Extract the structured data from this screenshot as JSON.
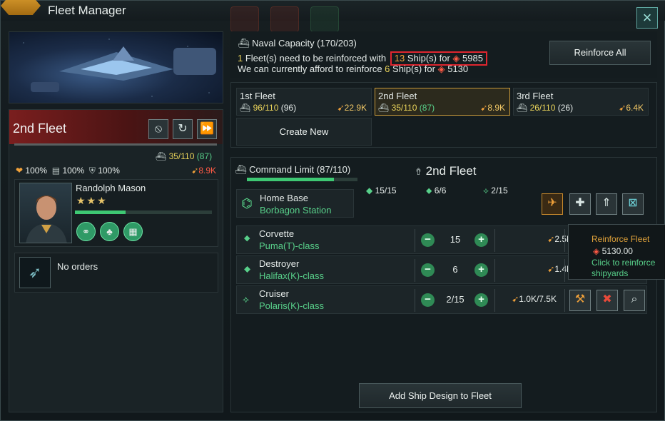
{
  "window": {
    "title": "Fleet Manager",
    "close_icon": "×"
  },
  "left": {
    "fleet_name": "2nd Fleet",
    "capacity": "35/110",
    "capacity_extra": "(87)",
    "stats": {
      "hull": "100%",
      "armor": "100%",
      "shield": "100%",
      "power": "8.9K"
    },
    "leader": {
      "name": "Randolph Mason",
      "stars": "★★★",
      "xp_fraction": 0.37
    },
    "orders": "No orders"
  },
  "top": {
    "naval_capacity": "Naval Capacity (170/203)",
    "line2": {
      "count": "1",
      "text": " Fleet(s) need to be reinforced with ",
      "ships": "13",
      "ships_text": " Ship(s) for ",
      "cost": "5985"
    },
    "line3": {
      "text": "We can currently afford to reinforce ",
      "ships": "6",
      "ships_text": " Ship(s) for ",
      "cost": "5130"
    },
    "reinforce_all": "Reinforce All"
  },
  "fleets": [
    {
      "name": "1st Fleet",
      "cap": "96/110",
      "extra": "(96)",
      "power": "22.9K"
    },
    {
      "name": "2nd Fleet",
      "cap": "35/110",
      "extra": "(87)",
      "power": "8.9K"
    },
    {
      "name": "3rd Fleet",
      "cap": "26/110",
      "extra": "(26)",
      "power": "6.4K"
    }
  ],
  "create_new": "Create New",
  "detail": {
    "command_limit": "Command Limit (87/110)",
    "command_fraction": 0.79,
    "fleet_title": "2nd Fleet",
    "home_base_label": "Home Base",
    "home_base": "Borbagon Station",
    "counts": {
      "small": "15/15",
      "medium": "6/6",
      "large": "2/15"
    }
  },
  "ships": [
    {
      "type": "Corvette",
      "design": "Puma(T)-class",
      "count": "15",
      "power": "2.5K"
    },
    {
      "type": "Destroyer",
      "design": "Halifax(K)-class",
      "count": "6",
      "power": "1.4K"
    },
    {
      "type": "Cruiser",
      "design": "Polaris(K)-class",
      "count": "2/15",
      "power": "1.0K/7.5K"
    }
  ],
  "tooltip": {
    "title": "Reinforce Fleet",
    "cost": "5130.00",
    "hint_line1": "Click to reinforce",
    "hint_line2": "shipyards"
  },
  "add_design": "Add Ship Design to Fleet",
  "colors": {
    "accent_green": "#58d08a",
    "orange": "#f2a23a",
    "red_highlight": "#e0262f"
  }
}
